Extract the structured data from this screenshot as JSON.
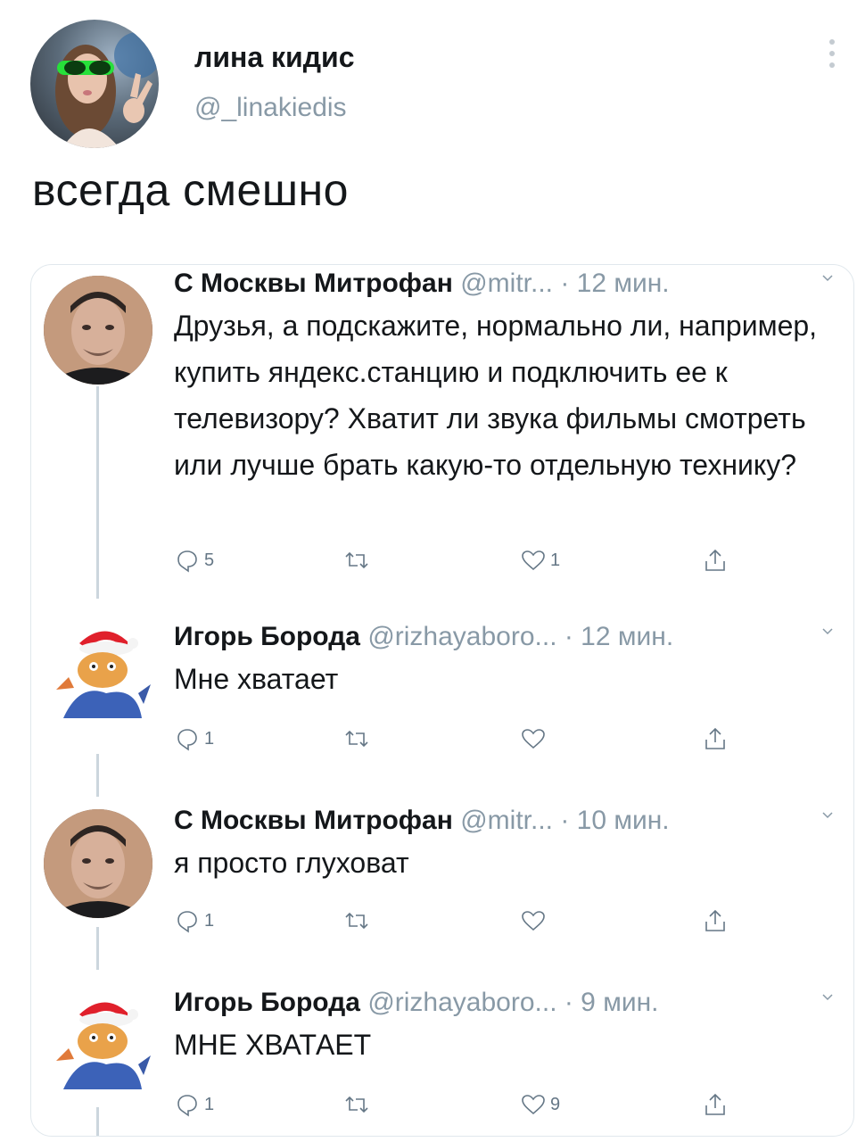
{
  "tweet": {
    "author_name": "лина кидис",
    "author_handle": "@_linakiedis",
    "text": "всегда смешно"
  },
  "replies": [
    {
      "name": "С Москвы Митрофан",
      "meta": "@mitr... · 12 мин.",
      "text": "Друзья, а подскажите, нормально ли, например, купить яндекс.станцию и подключить ее к телевизору? Хватит ли звука фильмы смотреть или лучше брать какую-то отдельную технику?",
      "reply_count": "5",
      "retweet_count": "",
      "like_count": "1"
    },
    {
      "name": "Игорь Борода",
      "meta": "@rizhayaboro... · 12 мин.",
      "text": "Мне хватает",
      "reply_count": "1",
      "retweet_count": "",
      "like_count": ""
    },
    {
      "name": "С Москвы Митрофан",
      "meta": "@mitr... · 10 мин.",
      "text": "я просто глуховат",
      "reply_count": "1",
      "retweet_count": "",
      "like_count": ""
    },
    {
      "name": "Игорь Борода",
      "meta": "@rizhayaboro... · 9 мин.",
      "text": "МНЕ ХВАТАЕТ",
      "reply_count": "1",
      "retweet_count": "",
      "like_count": "9"
    }
  ],
  "icons": {
    "reply": "reply-icon",
    "retweet": "retweet-icon",
    "like": "heart-icon",
    "share": "share-icon",
    "menu": "more-vertical-icon",
    "caret": "chevron-down-icon"
  },
  "colors": {
    "text": "#14171a",
    "secondary": "#8899a6",
    "icon": "#657786",
    "border": "#e1e8ed"
  }
}
